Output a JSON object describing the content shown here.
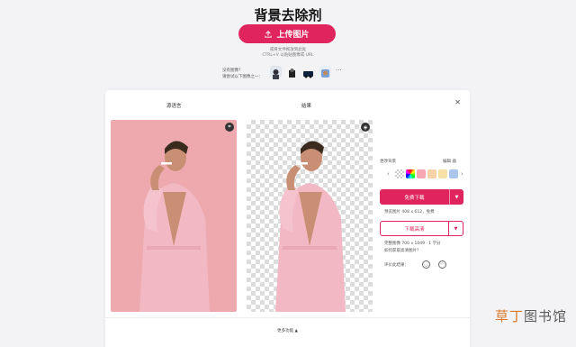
{
  "page": {
    "title": "背景去除剂",
    "upload_label": "上传图片",
    "hint_line1": "或将文件拖放到此处",
    "hint_line2": "CTRL+V 以粘贴图像或 URL",
    "samples_line1": "没有图像？",
    "samples_line2": "请尝试以下图像之一："
  },
  "card": {
    "tab_original": "源语言",
    "tab_result": "结果",
    "panel": {
      "background_label": "更改背景",
      "edit_label": "编辑 器",
      "free_download": "免费下载",
      "preview_info": "预览图片 408 x 612，免费",
      "hd_download": "下载高清",
      "full_info": "完整图像 700 x 1049 · 1 学分",
      "learn_more": "如何获取高清图片？",
      "rate_label": "评价此结果："
    },
    "more_tools": "更多功能"
  },
  "watermark": {
    "part1": "草丁",
    "part2": "图书馆"
  },
  "colors": {
    "accent": "#e0245e",
    "original_bg": "#eda9ae",
    "robe": "#f2b9c4"
  },
  "icons": {
    "upload": "upload-icon",
    "close": "close-icon",
    "crop": "crop-icon",
    "eraser": "eraser-icon",
    "swatch_transparent": "checkerboard-swatch",
    "happy": "happy-face-icon",
    "sad": "sad-face-icon"
  }
}
